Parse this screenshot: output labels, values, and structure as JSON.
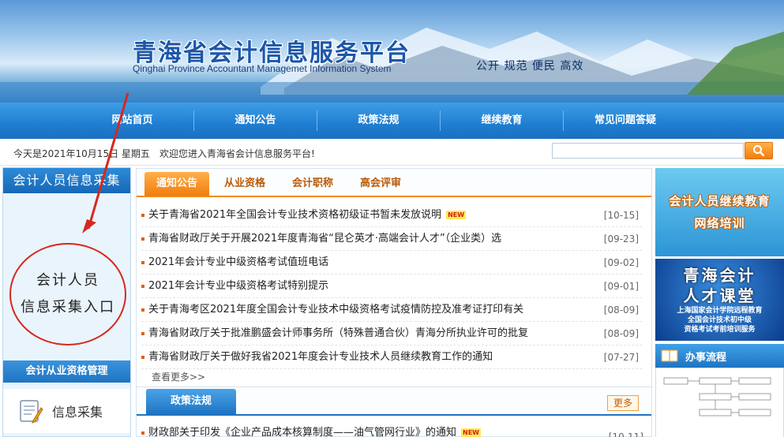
{
  "site": {
    "title": "青海省会计信息服务平台",
    "subtitle": "Qinghai Province Accountant Managemet Information System",
    "slogan": "公开  规范  便民  高效"
  },
  "nav": {
    "items": [
      "网站首页",
      "通知公告",
      "政策法规",
      "继续教育",
      "常见问题答疑"
    ]
  },
  "infobar": {
    "date": "今天是2021年10月15日 星期五",
    "welcome": "欢迎您进入青海省会计信息服务平台!",
    "search_value": ""
  },
  "left": {
    "header": "会计人员信息采集",
    "annotation_line1": "会计人员",
    "annotation_line2": "信息采集入口",
    "sub_header": "会计从业资格管理",
    "info_collect": "信息采集"
  },
  "main": {
    "tabs": [
      "通知公告",
      "从业资格",
      "会计职称",
      "高会评审"
    ],
    "news": [
      {
        "title": "关于青海省2021年全国会计专业技术资格初级证书暂未发放说明",
        "date": "[10-15]",
        "new": "NEW"
      },
      {
        "title": "青海省财政厅关于开展2021年度青海省“昆仑英才·高端会计人才”（企业类）选",
        "date": "[09-23]",
        "new": ""
      },
      {
        "title": "2021年会计专业中级资格考试值班电话",
        "date": "[09-02]",
        "new": ""
      },
      {
        "title": "2021年会计专业中级资格考试特别提示",
        "date": "[09-01]",
        "new": ""
      },
      {
        "title": "关于青海考区2021年度全国会计专业技术中级资格考试疫情防控及准考证打印有关",
        "date": "[08-09]",
        "new": ""
      },
      {
        "title": "青海省财政厅关于批准鹏盛会计师事务所（特殊普通合伙）青海分所执业许可的批复",
        "date": "[08-09]",
        "new": ""
      },
      {
        "title": "青海省财政厅关于做好我省2021年度会计专业技术人员继续教育工作的通知",
        "date": "[07-27]",
        "new": ""
      }
    ],
    "more": "查看更多>>",
    "policy_tab": "政策法规",
    "policy_more": "更多",
    "policy_first": {
      "title": "财政部关于印发《企业产品成本核算制度——油气管网行业》的通知",
      "date": "[10-11]",
      "new": "NEW"
    }
  },
  "right": {
    "promo1_line1": "会计人员继续教育",
    "promo1_line2": "网络培训",
    "promo2_line1": "青海会计",
    "promo2_line2": "人才课堂",
    "promo2_small1": "上海国家会计学院远程教育",
    "promo2_small2": "全国会计技术初中级",
    "promo2_small3": "资格考试考前培训服务",
    "workflow_label": "办事流程"
  }
}
